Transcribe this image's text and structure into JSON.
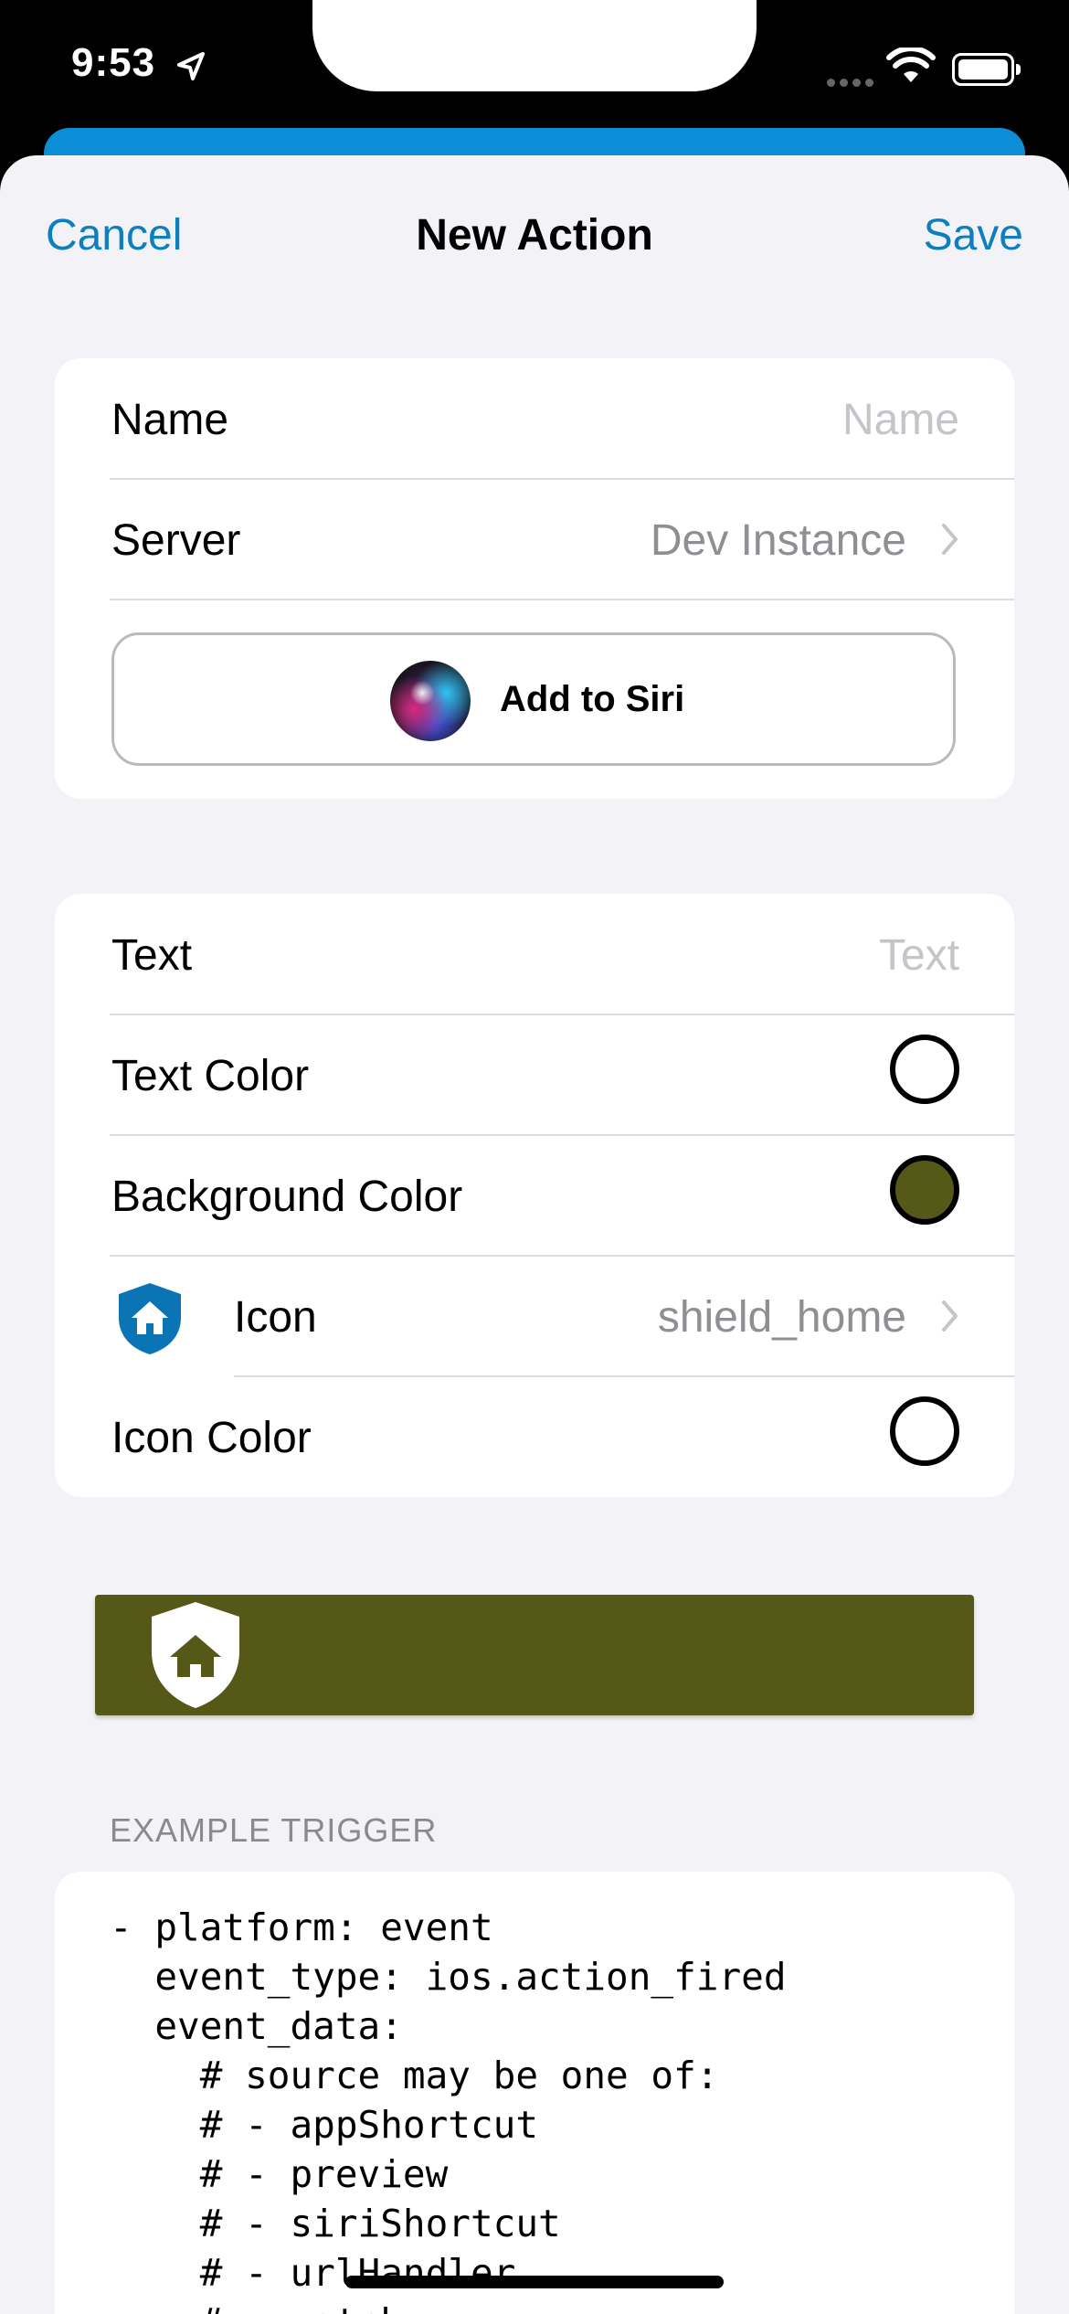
{
  "status_bar": {
    "time": "9:53"
  },
  "nav": {
    "cancel": "Cancel",
    "title": "New Action",
    "save": "Save"
  },
  "group1": {
    "name_label": "Name",
    "name_placeholder": "Name",
    "server_label": "Server",
    "server_value": "Dev Instance",
    "siri_button": "Add to Siri"
  },
  "group2": {
    "text_label": "Text",
    "text_placeholder": "Text",
    "text_color_label": "Text Color",
    "text_color": "#ffffff",
    "background_color_label": "Background Color",
    "background_color": "#555816",
    "icon_label": "Icon",
    "icon_value": "shield_home",
    "icon_color_label": "Icon Color",
    "icon_color": "#ffffff"
  },
  "preview": {
    "background": "#555816",
    "icon": "shield-home-icon"
  },
  "example": {
    "header": "EXAMPLE TRIGGER",
    "code": "- platform: event\n  event_type: ios.action_fired\n  event_data:\n    # source may be one of:\n    # - appShortcut\n    # - preview\n    # - siriShortcut\n    # - urlHandler\n    # - watch"
  },
  "colors": {
    "accent": "#0d7fbf",
    "header_blue": "#0b8ed6",
    "icon_blue": "#0b74b5"
  }
}
